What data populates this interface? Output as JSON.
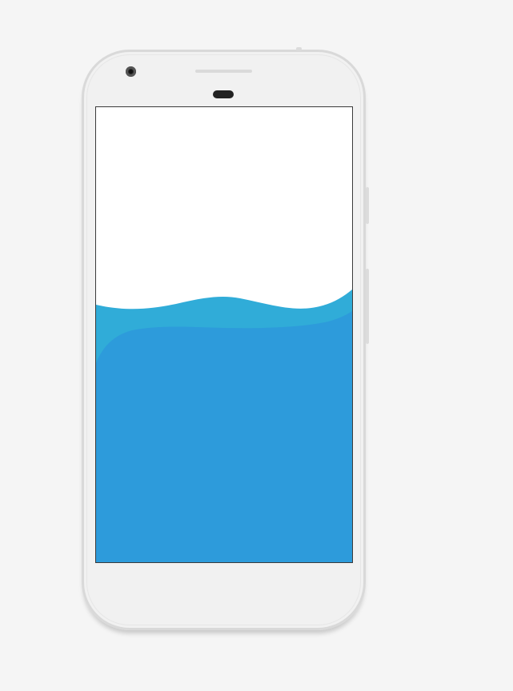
{
  "device": {
    "name": "smartphone",
    "frame_color": "#f1f1f1",
    "page_background": "#f5f5f5"
  },
  "screen": {
    "background": "#ffffff",
    "wave": {
      "back_color": "#30acd8",
      "front_color": "#2d9bdb"
    }
  }
}
